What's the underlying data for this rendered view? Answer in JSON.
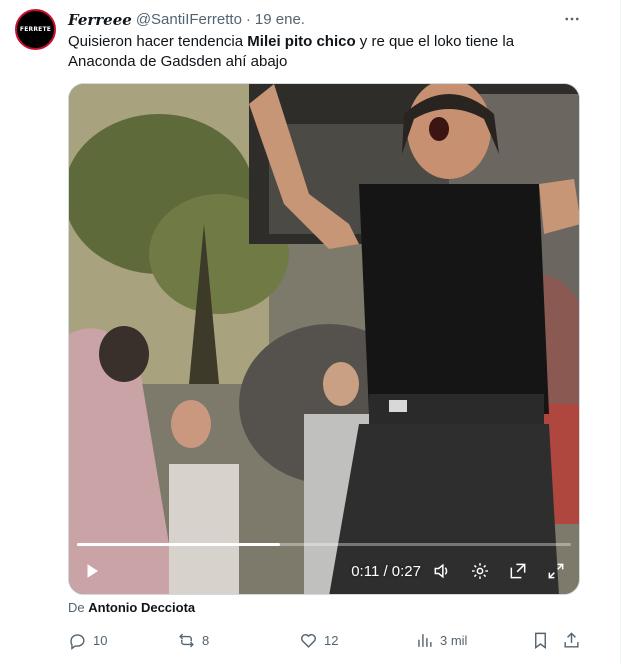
{
  "tweet": {
    "avatar_text": "FERRETE",
    "display_name": "Ferreee",
    "handle": "@SantiIFerretto",
    "dot": "·",
    "timestamp": "19 ene.",
    "text": {
      "part1": "Quisieron hacer tendencia ",
      "bold": "Milei pito chico",
      "part2": " y re que el loko tiene la Anaconda de Gadsden ahí abajo"
    }
  },
  "video": {
    "current_time": "0:11",
    "duration": "0:27",
    "time_display": "0:11 / 0:27",
    "progress": 0.41
  },
  "source": {
    "prefix": "De",
    "author": "Antonio Decciota"
  },
  "actions": {
    "replies": "10",
    "reposts": "8",
    "likes": "12",
    "views": "3 mil"
  },
  "colors": {
    "secondary_text": "#536471",
    "primary_text": "#0f1419",
    "border": "#cfd9de"
  },
  "icons": [
    "more-icon",
    "play-icon",
    "volume-icon",
    "settings-icon",
    "popout-icon",
    "fullscreen-icon",
    "reply-icon",
    "repost-icon",
    "like-icon",
    "views-icon",
    "bookmark-icon",
    "share-icon"
  ]
}
